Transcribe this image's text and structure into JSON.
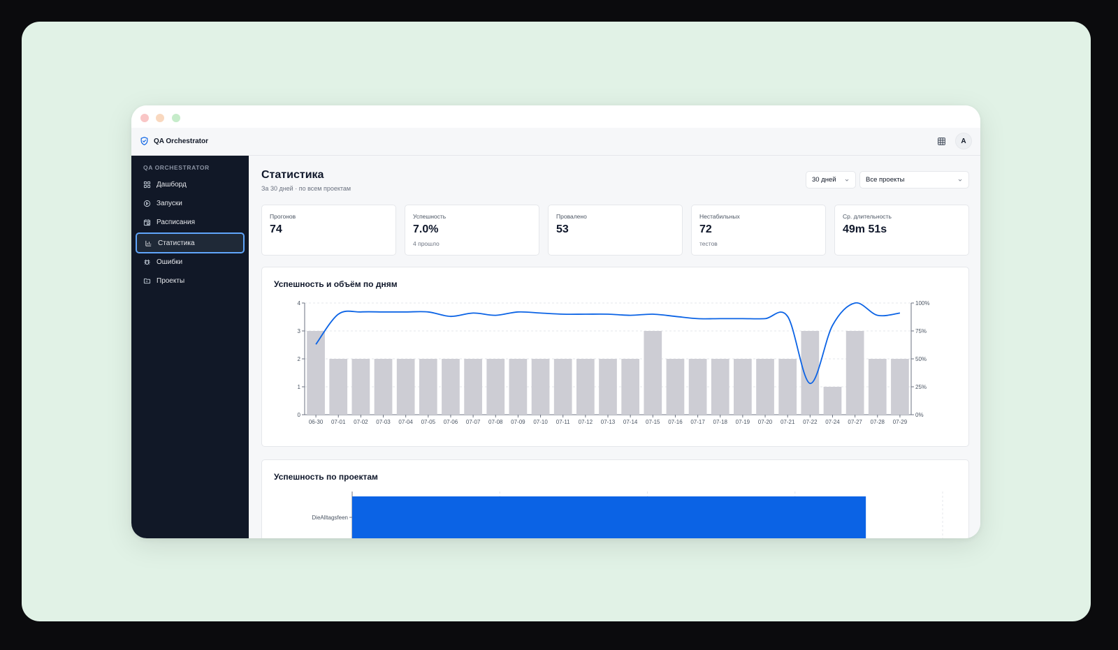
{
  "window": {
    "app_name": "QA Orchestrator",
    "avatar_initial": "A"
  },
  "sidebar": {
    "heading": "QA ORCHESTRATOR",
    "items": [
      {
        "label": "Дашборд",
        "icon": "dashboard-icon",
        "active": false
      },
      {
        "label": "Запуски",
        "icon": "play-circle-icon",
        "active": false
      },
      {
        "label": "Расписания",
        "icon": "calendar-clock-icon",
        "active": false
      },
      {
        "label": "Статистика",
        "icon": "bar-chart-icon",
        "active": true
      },
      {
        "label": "Ошибки",
        "icon": "bug-icon",
        "active": false
      },
      {
        "label": "Проекты",
        "icon": "folder-icon",
        "active": false
      }
    ]
  },
  "page": {
    "title": "Статистика",
    "subtitle": "За 30 дней · по всем проектам",
    "period_select": "30 дней",
    "project_select": "Все проекты"
  },
  "kpis": [
    {
      "label": "Прогонов",
      "value": "74",
      "sub": ""
    },
    {
      "label": "Успешность",
      "value": "7.0%",
      "sub": "4 прошло"
    },
    {
      "label": "Провалено",
      "value": "53",
      "sub": ""
    },
    {
      "label": "Нестабильных",
      "value": "72",
      "sub": "тестов"
    },
    {
      "label": "Ср. длительность",
      "value": "49m 51s",
      "sub": ""
    }
  ],
  "daily_panel": {
    "title": "Успешность и объём по дням"
  },
  "projects_panel": {
    "title": "Успешность по проектам"
  },
  "colors": {
    "accent": "#0b63e5",
    "bar": "#cdcdd4",
    "sidebar_bg": "#111827",
    "active_border": "#60a5fa"
  },
  "chart_data": [
    {
      "type": "bar",
      "title": "Успешность и объём по дням",
      "categories": [
        "06-30",
        "07-01",
        "07-02",
        "07-03",
        "07-04",
        "07-05",
        "07-06",
        "07-07",
        "07-08",
        "07-09",
        "07-10",
        "07-11",
        "07-12",
        "07-13",
        "07-14",
        "07-15",
        "07-16",
        "07-17",
        "07-18",
        "07-19",
        "07-20",
        "07-21",
        "07-22",
        "07-24",
        "07-27",
        "07-28",
        "07-29"
      ],
      "series": [
        {
          "type": "bar",
          "axis": "left",
          "values": [
            3,
            2,
            2,
            2,
            2,
            2,
            2,
            2,
            2,
            2,
            2,
            2,
            2,
            2,
            2,
            3,
            2,
            2,
            2,
            2,
            2,
            2,
            3,
            1,
            3,
            2,
            2
          ]
        },
        {
          "type": "line",
          "axis": "right",
          "values": [
            63,
            90,
            92,
            92,
            92,
            92,
            88,
            91,
            89,
            92,
            91,
            90,
            90,
            90,
            89,
            90,
            88,
            86,
            86,
            86,
            86,
            88,
            28,
            80,
            100,
            89,
            91
          ]
        }
      ],
      "ylim_left": [
        0,
        4
      ],
      "yticks_left": [
        "0",
        "1",
        "2",
        "3",
        "4"
      ],
      "ylim_right": [
        0,
        100
      ],
      "yticks_right": [
        "0%",
        "25%",
        "50%",
        "75%",
        "100%"
      ],
      "grid": true
    },
    {
      "type": "bar",
      "orientation": "horizontal",
      "title": "Успешность по проектам",
      "categories": [
        "DieAlltagsfeen"
      ],
      "values": [
        87
      ]
    }
  ]
}
